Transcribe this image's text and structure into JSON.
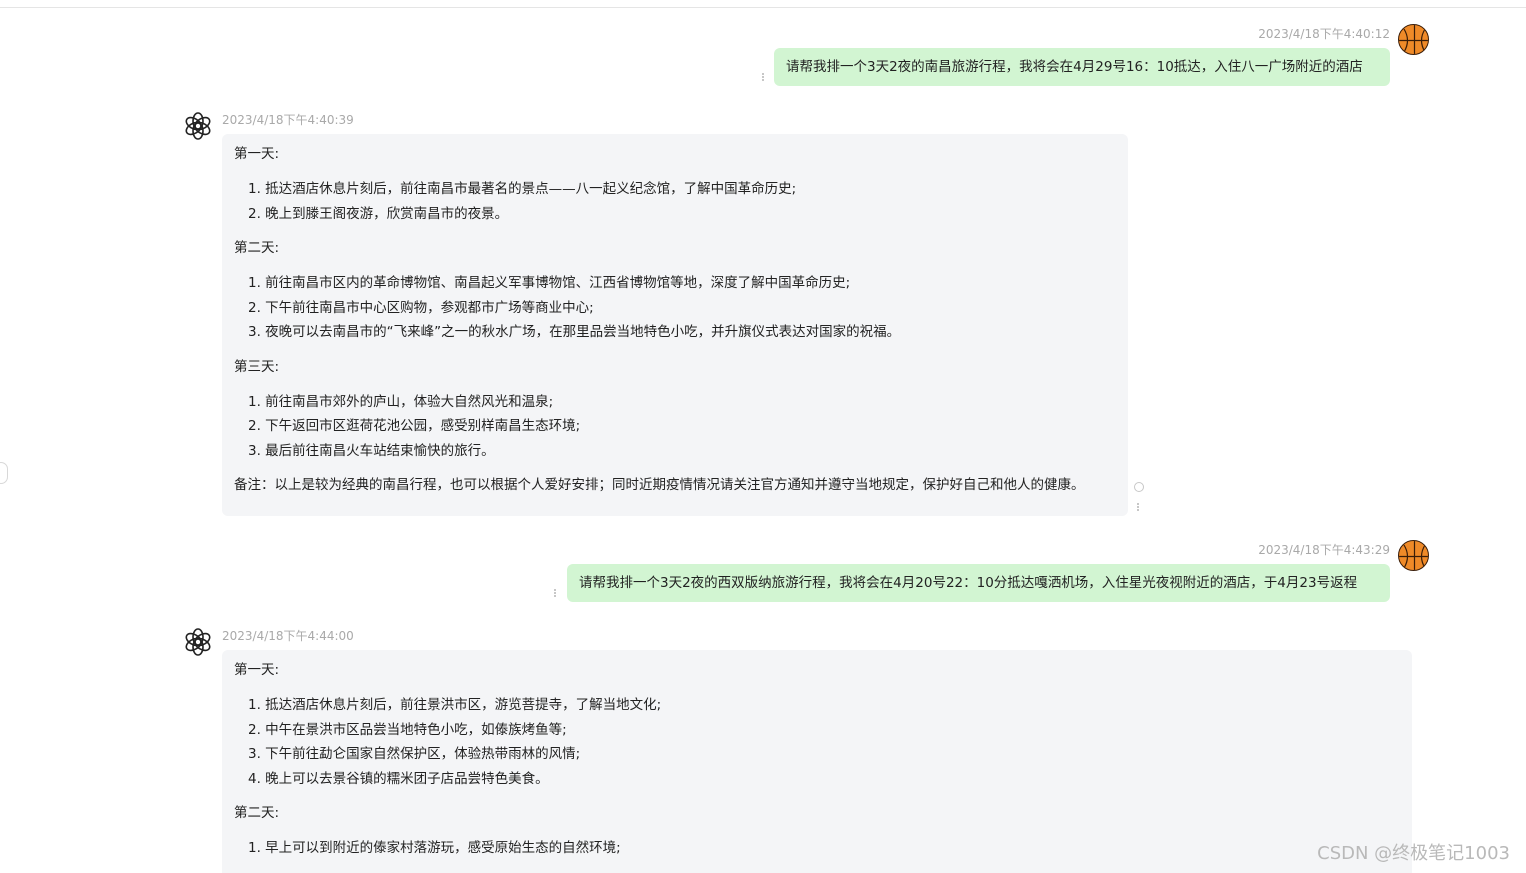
{
  "messages": [
    {
      "role": "user",
      "timestamp": "2023/4/18下午4:40:12",
      "text": "请帮我排一个3天2夜的南昌旅游行程，我将会在4月29号16：10抵达，入住八一广场附近的酒店"
    },
    {
      "role": "assistant",
      "timestamp": "2023/4/18下午4:40:39",
      "days": [
        {
          "title": "第一天:",
          "items": [
            "1. 抵达酒店休息片刻后，前往南昌市最著名的景点——八一起义纪念馆，了解中国革命历史;",
            "2. 晚上到滕王阁夜游，欣赏南昌市的夜景。"
          ]
        },
        {
          "title": "第二天:",
          "items": [
            "1. 前往南昌市区内的革命博物馆、南昌起义军事博物馆、江西省博物馆等地，深度了解中国革命历史;",
            "2. 下午前往南昌市中心区购物，参观都市广场等商业中心;",
            "3. 夜晚可以去南昌市的“飞来峰”之一的秋水广场，在那里品尝当地特色小吃，并升旗仪式表达对国家的祝福。"
          ]
        },
        {
          "title": "第三天:",
          "items": [
            "1. 前往南昌市郊外的庐山，体验大自然风光和温泉;",
            "2. 下午返回市区逛荷花池公园，感受别样南昌生态环境;",
            "3. 最后前往南昌火车站结束愉快的旅行。"
          ]
        }
      ],
      "note": "备注：以上是较为经典的南昌行程，也可以根据个人爱好安排；同时近期疫情情况请关注官方通知并遵守当地规定，保护好自己和他人的健康。"
    },
    {
      "role": "user",
      "timestamp": "2023/4/18下午4:43:29",
      "text": "请帮我排一个3天2夜的西双版纳旅游行程，我将会在4月20号22：10分抵达嘎洒机场，入住星光夜视附近的酒店，于4月23号返程"
    },
    {
      "role": "assistant",
      "timestamp": "2023/4/18下午4:44:00",
      "days": [
        {
          "title": "第一天:",
          "items": [
            "1. 抵达酒店休息片刻后，前往景洪市区，游览菩提寺，了解当地文化;",
            "2. 中午在景洪市区品尝当地特色小吃，如傣族烤鱼等;",
            "3. 下午前往勐仑国家自然保护区，体验热带雨林的风情;",
            "4. 晚上可以去景谷镇的糯米团子店品尝特色美食。"
          ]
        },
        {
          "title": "第二天:",
          "items": [
            "1. 早上可以到附近的傣家村落游玩，感受原始生态的自然环境;"
          ]
        }
      ]
    }
  ],
  "icons": {
    "user_avatar": "basketball-icon",
    "bot_avatar": "openai-logo-icon"
  },
  "colors": {
    "user_bubble": "#d2f5d2",
    "bot_bubble": "#f4f5f7",
    "timestamp": "#a9a9a9"
  },
  "watermark": "CSDN @终极笔记1003"
}
